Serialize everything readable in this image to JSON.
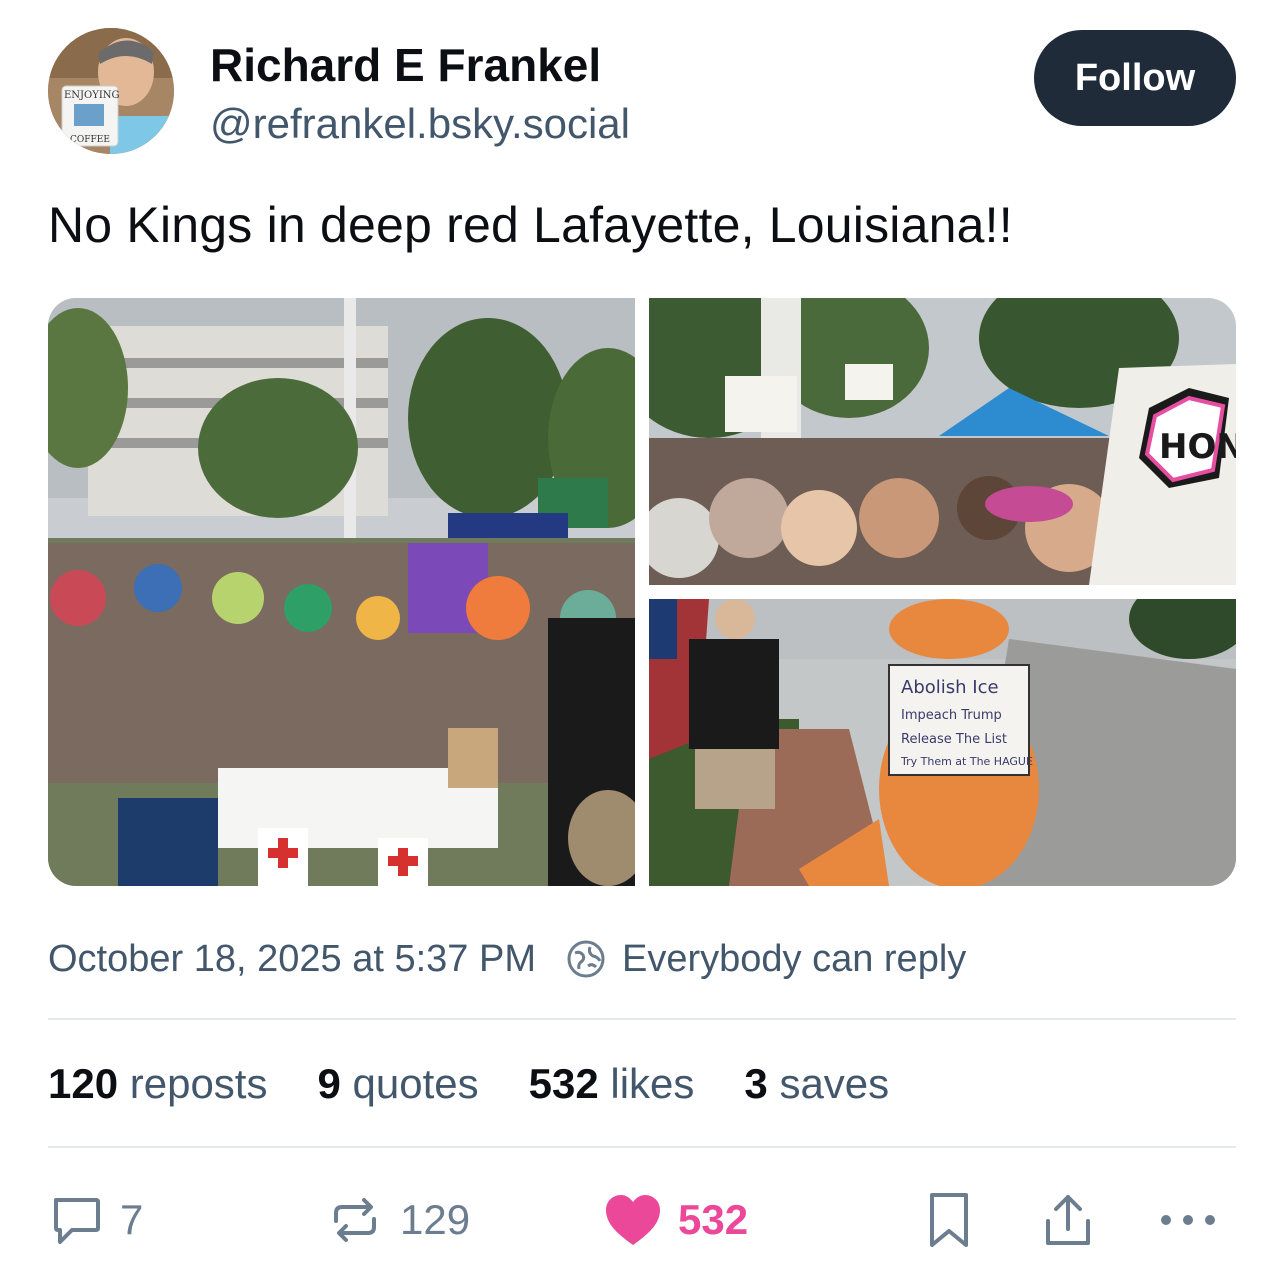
{
  "author": {
    "display_name": "Richard E Frankel",
    "handle": "@refrankel.bsky.social",
    "avatar_icon": "avatar-photo"
  },
  "follow_label": "Follow",
  "post": {
    "text": "No Kings in deep red Lafayette, Louisiana!!",
    "images": [
      {
        "name": "rally-crowd-photo"
      },
      {
        "name": "protest-signs-photo"
      },
      {
        "name": "dinosaur-costume-photo"
      }
    ]
  },
  "meta": {
    "timestamp": "October 18, 2025 at 5:37 PM",
    "reply_setting": "Everybody can reply",
    "reply_icon": "globe-icon"
  },
  "stats": {
    "reposts_count": "120",
    "reposts_label": "reposts",
    "quotes_count": "9",
    "quotes_label": "quotes",
    "likes_count": "532",
    "likes_label": "likes",
    "saves_count": "3",
    "saves_label": "saves"
  },
  "actions": {
    "reply_count": "7",
    "repost_count": "129",
    "like_count": "532"
  },
  "colors": {
    "follow_bg": "#1f2b38",
    "muted_text": "#42576c",
    "like_pink": "#ec4899",
    "divider": "#e4e9ee"
  }
}
